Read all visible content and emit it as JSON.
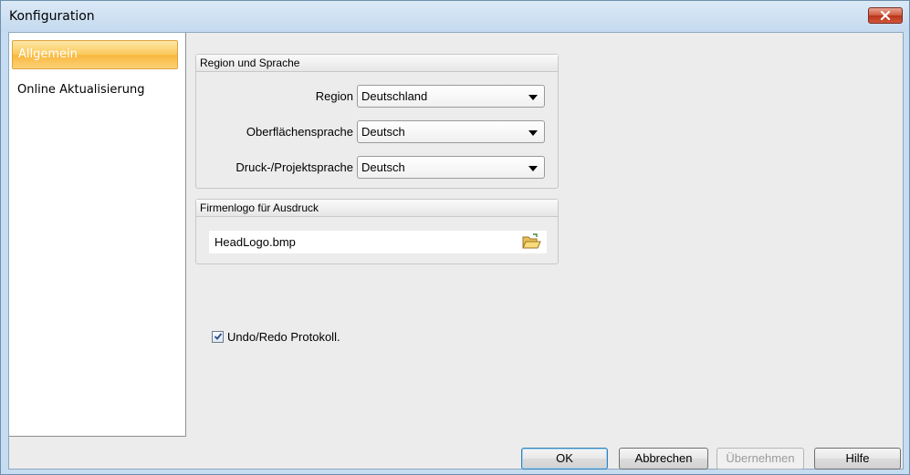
{
  "window": {
    "title": "Konfiguration"
  },
  "sidebar": {
    "items": [
      {
        "label": "Allgemein",
        "selected": true
      },
      {
        "label": "Online Aktualisierung",
        "selected": false
      }
    ]
  },
  "region_group": {
    "header": "Region und Sprache",
    "rows": [
      {
        "label": "Region",
        "value": "Deutschland"
      },
      {
        "label": "Oberflächensprache",
        "value": "Deutsch"
      },
      {
        "label": "Druck-/Projektsprache",
        "value": "Deutsch"
      }
    ]
  },
  "logo_group": {
    "header": "Firmenlogo für Ausdruck",
    "file_value": "HeadLogo.bmp",
    "browse_icon": "folder-open-icon"
  },
  "undo": {
    "label": "Undo/Redo Protokoll.",
    "checked": true
  },
  "buttons": {
    "ok": "OK",
    "cancel": "Abbrechen",
    "apply": "Übernehmen",
    "help": "Hilfe"
  },
  "colors": {
    "selection_orange": "#fbc85c",
    "window_frame": "#c6dcf0",
    "close_red": "#cf5a3e"
  }
}
